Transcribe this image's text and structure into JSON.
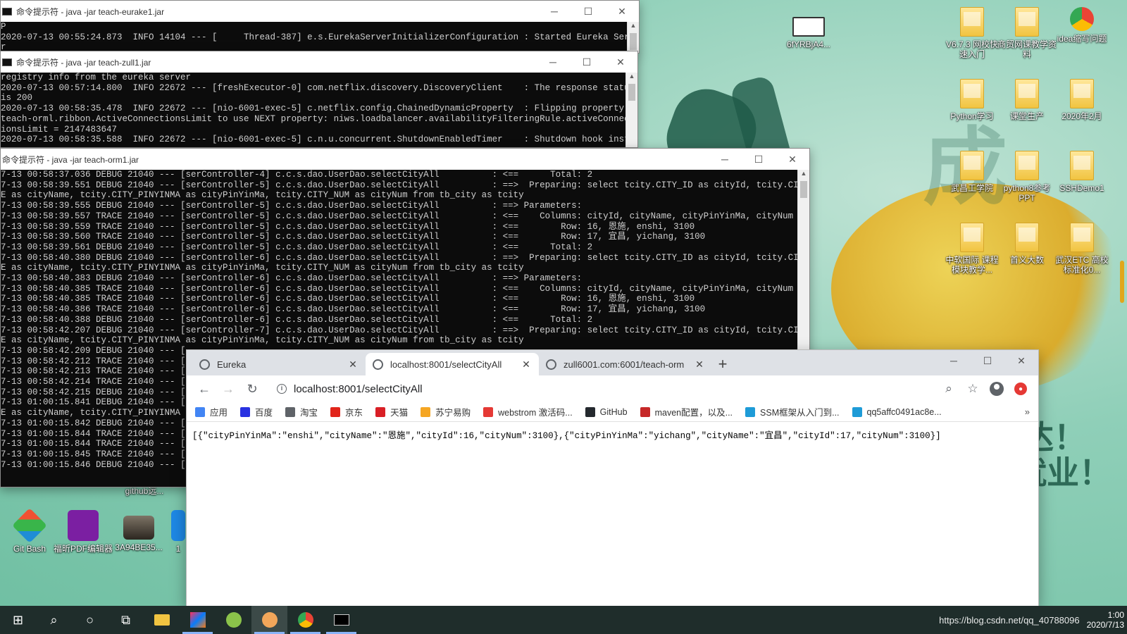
{
  "desktop": {
    "deco_texts": [
      "成",
      "达！",
      "就业！"
    ],
    "icons_right": [
      {
        "label": "V6.7.3 网校快速入门",
        "kind": "folder"
      },
      {
        "label": "商贸网课教学资料",
        "kind": "folder"
      },
      {
        "label": "idea缩写问题",
        "kind": "chrome"
      },
      {
        "label": "Python学习",
        "kind": "folder"
      },
      {
        "label": "课堂生产",
        "kind": "folder"
      },
      {
        "label": "2020年2月",
        "kind": "folder"
      },
      {
        "label": "武昌工学院",
        "kind": "folder"
      },
      {
        "label": "python8参考PPT",
        "kind": "folder"
      },
      {
        "label": "SSHDemo1",
        "kind": "folder"
      },
      {
        "label": "中软国际 课程模块教学...",
        "kind": "folder"
      },
      {
        "label": "首义大数",
        "kind": "folder"
      },
      {
        "label": "武汉ETC 高校标准化0...",
        "kind": "folder"
      }
    ],
    "icon_top": {
      "label": "6fYRBjA4..."
    },
    "icons_bottom": [
      {
        "label": "github远...",
        "kind": "text"
      },
      {
        "label": "Git Bash",
        "kind": "git"
      },
      {
        "label": "福昕PDF编辑器",
        "kind": "pdf"
      },
      {
        "label": "3A94BE35...",
        "kind": "img"
      },
      {
        "label": "1",
        "kind": "partial"
      }
    ]
  },
  "cmd_windows": [
    {
      "title": "命令提示符 - java  -jar teach-eurake1.jar",
      "lines": [
        "P",
        "2020-07-13 00:55:24.873  INFO 14104 --- [     Thread-387] e.s.EurekaServerInitializerConfiguration : Started Eureka Serv",
        "r"
      ]
    },
    {
      "title": "命令提示符 - java  -jar teach-zull1.jar",
      "lines": [
        "registry info from the eureka server",
        "2020-07-13 00:57:14.800  INFO 22672 --- [freshExecutor-0] com.netflix.discovery.DiscoveryClient    : The response status",
        "is 200",
        "2020-07-13 00:58:35.478  INFO 22672 --- [nio-6001-exec-5] c.netflix.config.ChainedDynamicProperty  : Flipping property:",
        "teach-orml.ribbon.ActiveConnectionsLimit to use NEXT property: niws.loadbalancer.availabilityFilteringRule.activeConnect",
        "ionsLimit = 2147483647",
        "2020-07-13 00:58:35.588  INFO 22672 --- [nio-6001-exec-5] c.n.u.concurrent.ShutdownEnabledTimer    : Shutdown hook insta"
      ]
    },
    {
      "title": "命令提示符 - java  -jar teach-orm1.jar",
      "lines": [
        "7-13 00:58:37.036 DEBUG 21040 --- [serController-4] c.c.s.dao.UserDao.selectCityAll          : <==      Total: 2",
        "7-13 00:58:39.551 DEBUG 21040 --- [serController-5] c.c.s.dao.UserDao.selectCityAll          : ==>  Preparing: select tcity.CITY_ID as cityId, tcity.CI",
        "E as cityName, tcity.CITY_PINYINMA as cityPinYinMa, tcity.CITY_NUM as cityNum from tb_city as tcity",
        "7-13 00:58:39.555 DEBUG 21040 --- [serController-5] c.c.s.dao.UserDao.selectCityAll          : ==> Parameters:",
        "7-13 00:58:39.557 TRACE 21040 --- [serController-5] c.c.s.dao.UserDao.selectCityAll          : <==    Columns: cityId, cityName, cityPinYinMa, cityNum",
        "7-13 00:58:39.559 TRACE 21040 --- [serController-5] c.c.s.dao.UserDao.selectCityAll          : <==        Row: 16, 恩施, enshi, 3100",
        "7-13 00:58:39.560 TRACE 21040 --- [serController-5] c.c.s.dao.UserDao.selectCityAll          : <==        Row: 17, 宜昌, yichang, 3100",
        "7-13 00:58:39.561 DEBUG 21040 --- [serController-5] c.c.s.dao.UserDao.selectCityAll          : <==      Total: 2",
        "7-13 00:58:40.380 DEBUG 21040 --- [serController-6] c.c.s.dao.UserDao.selectCityAll          : ==>  Preparing: select tcity.CITY_ID as cityId, tcity.CI",
        "E as cityName, tcity.CITY_PINYINMA as cityPinYinMa, tcity.CITY_NUM as cityNum from tb_city as tcity",
        "7-13 00:58:40.383 DEBUG 21040 --- [serController-6] c.c.s.dao.UserDao.selectCityAll          : ==> Parameters:",
        "7-13 00:58:40.385 TRACE 21040 --- [serController-6] c.c.s.dao.UserDao.selectCityAll          : <==    Columns: cityId, cityName, cityPinYinMa, cityNum",
        "7-13 00:58:40.385 TRACE 21040 --- [serController-6] c.c.s.dao.UserDao.selectCityAll          : <==        Row: 16, 恩施, enshi, 3100",
        "7-13 00:58:40.386 TRACE 21040 --- [serController-6] c.c.s.dao.UserDao.selectCityAll          : <==        Row: 17, 宜昌, yichang, 3100",
        "7-13 00:58:40.388 DEBUG 21040 --- [serController-6] c.c.s.dao.UserDao.selectCityAll          : <==      Total: 2",
        "7-13 00:58:42.207 DEBUG 21040 --- [serController-7] c.c.s.dao.UserDao.selectCityAll          : ==>  Preparing: select tcity.CITY_ID as cityId, tcity.CI",
        "E as cityName, tcity.CITY_PINYINMA as cityPinYinMa, tcity.CITY_NUM as cityNum from tb_city as tcity",
        "7-13 00:58:42.209 DEBUG 21040 --- [",
        "7-13 00:58:42.212 TRACE 21040 --- [",
        "7-13 00:58:42.213 TRACE 21040 --- [",
        "7-13 00:58:42.214 TRACE 21040 --- [",
        "7-13 00:58:42.215 DEBUG 21040 --- [",
        "7-13 01:00:15.841 DEBUG 21040 --- [",
        "E as cityName, tcity.CITY_PINYINMA",
        "7-13 01:00:15.842 DEBUG 21040 --- [",
        "7-13 01:00:15.844 TRACE 21040 --- [",
        "7-13 01:00:15.844 TRACE 21040 --- [",
        "7-13 01:00:15.845 TRACE 21040 --- [",
        "7-13 01:00:15.846 DEBUG 21040 --- ["
      ]
    }
  ],
  "browser": {
    "tabs": [
      {
        "label": "Eureka",
        "active": false
      },
      {
        "label": "localhost:8001/selectCityAll",
        "active": true
      },
      {
        "label": "zull6001.com:6001/teach-orm",
        "active": false
      }
    ],
    "new_tab": "+",
    "url": "localhost:8001/selectCityAll",
    "bookmarks": [
      {
        "label": "应用",
        "color": "#4285f4",
        "icon": "apps"
      },
      {
        "label": "百度",
        "color": "#2932e1",
        "icon": "baidu"
      },
      {
        "label": "淘宝",
        "color": "#5f6368",
        "icon": "globe"
      },
      {
        "label": "京东",
        "color": "#e1251b",
        "icon": "JD"
      },
      {
        "label": "天猫",
        "color": "#d91f26",
        "icon": "T"
      },
      {
        "label": "苏宁易购",
        "color": "#f5a623",
        "icon": "suning"
      },
      {
        "label": "webstrom 激活码...",
        "color": "#e53935",
        "icon": "book"
      },
      {
        "label": "GitHub",
        "color": "#24292e",
        "icon": "github"
      },
      {
        "label": "maven配置，以及...",
        "color": "#c62828",
        "icon": "C"
      },
      {
        "label": "SSM框架从入门到...",
        "color": "#1e9bd7",
        "icon": "S"
      },
      {
        "label": "qq5affc0491ac8e...",
        "color": "#1e9bd7",
        "icon": "S"
      }
    ],
    "more_bookmarks": "»",
    "body_text": "[{\"cityPinYinMa\":\"enshi\",\"cityName\":\"恩施\",\"cityId\":16,\"cityNum\":3100},{\"cityPinYinMa\":\"yichang\",\"cityName\":\"宜昌\",\"cityId\":17,\"cityNum\":3100}]"
  },
  "taskbar": {
    "items": [
      "start",
      "search",
      "cortana",
      "task-view",
      "file-explorer",
      "intellij",
      "app-green",
      "app-browser",
      "chrome",
      "terminal"
    ],
    "tray_text": "https://blog.csdn.net/qq_40788096",
    "time": "1:00",
    "date": "2020/7/13"
  }
}
